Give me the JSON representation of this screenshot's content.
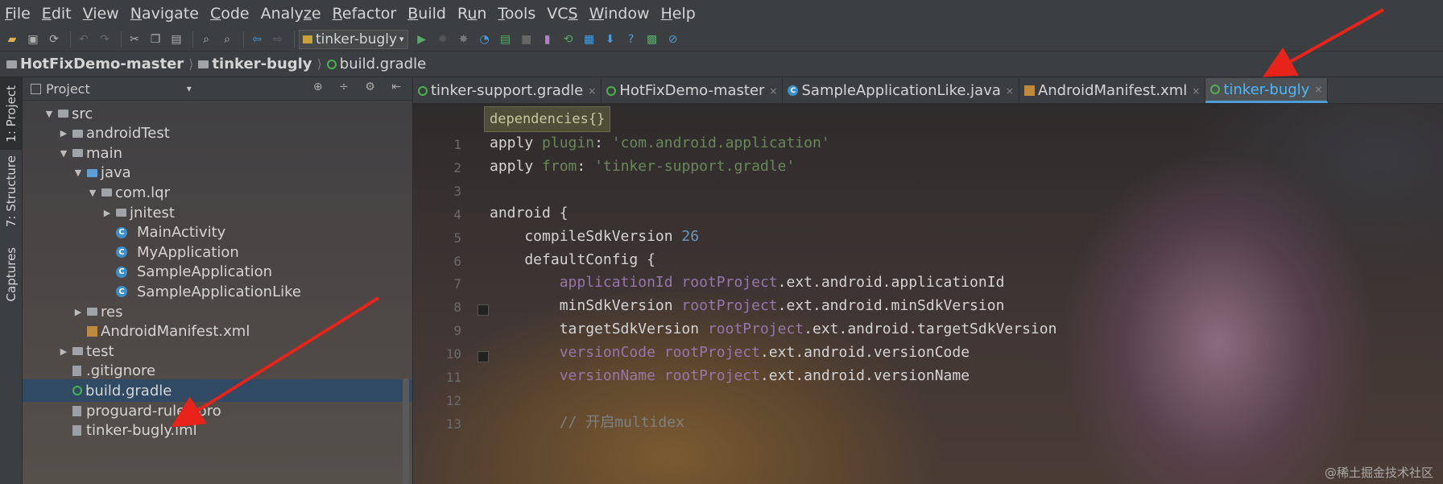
{
  "menu": [
    "File",
    "Edit",
    "View",
    "Navigate",
    "Code",
    "Analyze",
    "Refactor",
    "Build",
    "Run",
    "Tools",
    "VCS",
    "Window",
    "Help"
  ],
  "menu_underline": [
    "F",
    "E",
    "V",
    "N",
    "C",
    "z",
    "R",
    "B",
    "u",
    "T",
    "S",
    "W",
    "H"
  ],
  "toolbar": {
    "run_config": "tinker-bugly"
  },
  "breadcrumb": [
    "HotFixDemo-master",
    "tinker-bugly",
    "build.gradle"
  ],
  "side_tabs": [
    "1: Project",
    "7: Structure",
    "Captures"
  ],
  "project_panel": {
    "title": "Project",
    "tree": [
      {
        "label": "src",
        "indent": 1,
        "arrow": "open",
        "icon": "folder"
      },
      {
        "label": "androidTest",
        "indent": 2,
        "arrow": "closed",
        "icon": "folder"
      },
      {
        "label": "main",
        "indent": 2,
        "arrow": "open",
        "icon": "folder"
      },
      {
        "label": "java",
        "indent": 3,
        "arrow": "open",
        "icon": "folder-blue"
      },
      {
        "label": "com.lqr",
        "indent": 4,
        "arrow": "open",
        "icon": "package"
      },
      {
        "label": "jnitest",
        "indent": 5,
        "arrow": "closed",
        "icon": "package"
      },
      {
        "label": "MainActivity",
        "indent": 5,
        "arrow": "none",
        "icon": "class"
      },
      {
        "label": "MyApplication",
        "indent": 5,
        "arrow": "none",
        "icon": "class"
      },
      {
        "label": "SampleApplication",
        "indent": 5,
        "arrow": "none",
        "icon": "class"
      },
      {
        "label": "SampleApplicationLike",
        "indent": 5,
        "arrow": "none",
        "icon": "class"
      },
      {
        "label": "res",
        "indent": 3,
        "arrow": "closed",
        "icon": "folder"
      },
      {
        "label": "AndroidManifest.xml",
        "indent": 3,
        "arrow": "none",
        "icon": "xml"
      },
      {
        "label": "test",
        "indent": 2,
        "arrow": "closed",
        "icon": "folder"
      },
      {
        "label": ".gitignore",
        "indent": 2,
        "arrow": "none",
        "icon": "file"
      },
      {
        "label": "build.gradle",
        "indent": 2,
        "arrow": "none",
        "icon": "gradle",
        "selected": true
      },
      {
        "label": "proguard-rules.pro",
        "indent": 2,
        "arrow": "none",
        "icon": "file"
      },
      {
        "label": "tinker-bugly.iml",
        "indent": 2,
        "arrow": "none",
        "icon": "file"
      }
    ]
  },
  "editor_tabs": [
    {
      "label": "tinker-support.gradle",
      "icon": "gradle"
    },
    {
      "label": "HotFixDemo-master",
      "icon": "gradle"
    },
    {
      "label": "SampleApplicationLike.java",
      "icon": "class"
    },
    {
      "label": "AndroidManifest.xml",
      "icon": "xml"
    },
    {
      "label": "tinker-bugly",
      "icon": "gradle",
      "active": true
    }
  ],
  "editor_breadcrumb": "dependencies{}",
  "line_numbers": [
    "1",
    "2",
    "3",
    "4",
    "5",
    "6",
    "7",
    "8",
    "9",
    "10",
    "11",
    "12",
    "13"
  ],
  "code_lines": [
    [
      {
        "t": "apply ",
        "c": "kw"
      },
      {
        "t": "plugin",
        "c": "str"
      },
      {
        "t": ": ",
        "c": "plain"
      },
      {
        "t": "'com.android.application'",
        "c": "str"
      }
    ],
    [
      {
        "t": "apply ",
        "c": "kw"
      },
      {
        "t": "from",
        "c": "str"
      },
      {
        "t": ": ",
        "c": "plain"
      },
      {
        "t": "'tinker-support.gradle'",
        "c": "str"
      }
    ],
    [],
    [
      {
        "t": "android {",
        "c": "plain"
      }
    ],
    [
      {
        "t": "    compileSdkVersion ",
        "c": "plain"
      },
      {
        "t": "26",
        "c": "num"
      }
    ],
    [
      {
        "t": "    defaultConfig {",
        "c": "plain"
      }
    ],
    [
      {
        "t": "        ",
        "c": "plain"
      },
      {
        "t": "applicationId ",
        "c": "prop"
      },
      {
        "t": "rootProject",
        "c": "prop"
      },
      {
        "t": ".ext.android.applicationId",
        "c": "plain"
      }
    ],
    [
      {
        "t": "        minSdkVersion ",
        "c": "plain"
      },
      {
        "t": "rootProject",
        "c": "prop"
      },
      {
        "t": ".ext.android.minSdkVersion",
        "c": "plain"
      }
    ],
    [
      {
        "t": "        targetSdkVersion ",
        "c": "plain"
      },
      {
        "t": "rootProject",
        "c": "prop"
      },
      {
        "t": ".ext.android.targetSdkVersion",
        "c": "plain"
      }
    ],
    [
      {
        "t": "        ",
        "c": "plain"
      },
      {
        "t": "versionCode ",
        "c": "prop"
      },
      {
        "t": "rootProject",
        "c": "prop"
      },
      {
        "t": ".ext.android.versionCode",
        "c": "plain"
      }
    ],
    [
      {
        "t": "        ",
        "c": "plain"
      },
      {
        "t": "versionName ",
        "c": "prop"
      },
      {
        "t": "rootProject",
        "c": "prop"
      },
      {
        "t": ".ext.android.versionName",
        "c": "plain"
      }
    ],
    [],
    [
      {
        "t": "        // 开启multidex",
        "c": "cmt"
      }
    ]
  ],
  "watermark": "@稀土掘金技术社区"
}
